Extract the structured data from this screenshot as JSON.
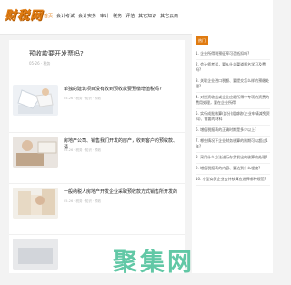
{
  "header": {
    "logo_text": "财税网",
    "nav": [
      "首页",
      "会计考试",
      "会计实务",
      "审计",
      "税务",
      "评估",
      "其它知识",
      "其它云商"
    ]
  },
  "main": {
    "title": "预收款要开发票吗?",
    "meta": "05-26 · 税务",
    "articles": [
      {
        "title": "单独的建筑项目没有收到预收款要预缴增值税吗?",
        "meta": "05-26 · 税务 · 知识 · 预收"
      },
      {
        "title": "房地产公司、销售我们开发的房产，收到客户的预收款、请",
        "meta": "05-26 · 税务 · 知识 · 预收"
      },
      {
        "title": "一般纳税人房地产开发企业采取预收款方式销售所开发的",
        "meta": "05-26 · 税务 · 知识 · 预收"
      },
      {
        "title": "",
        "meta": ""
      }
    ]
  },
  "sidebar": {
    "tab_label": "热门",
    "items": [
      "1. 企业所得税预征率可否抵扣吗?",
      "2. 会计师考试，要从什么渠道报名学习及费吗?",
      "3. 关联企业进口税额、要提交怎么样的预缴处理?",
      "4. 对投资收益或企业应缴所得中专项的资费的费用处理，要在企业所得",
      "5. 实行成批核算(部分)组减收(企业申请减免资料)、需要的材料",
      "6. 增值税报表的正确时期是多少以上?",
      "7. 哪些情况下企业财务核算的账期可以超过1年?",
      "8. 采用什么方法进行存货发出的核算的处理?",
      "9. 增值税报表的内容、要达到什么程度?",
      "10. 小型商贸企业会计核算应选择哪种规范?"
    ]
  },
  "watermark": "聚集网",
  "colors": {
    "accent": "#e07b10",
    "watermark": "#46be96"
  }
}
